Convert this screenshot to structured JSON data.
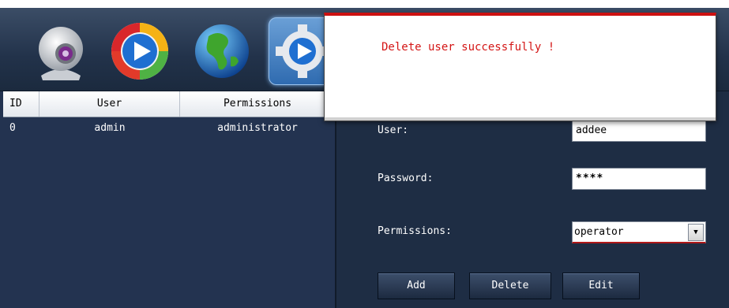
{
  "toolbar": {
    "icons": [
      "webcam-icon",
      "play-icon",
      "globe-icon",
      "settings-gear-icon"
    ]
  },
  "user_table": {
    "headers": {
      "id": "ID",
      "user": "User",
      "permissions": "Permissions"
    },
    "rows": [
      {
        "id": "0",
        "user": "admin",
        "permissions": "administrator"
      }
    ]
  },
  "form": {
    "user_label": "User:",
    "user_value": "addee",
    "password_label": "Password:",
    "password_value": "****",
    "permissions_label": "Permissions:",
    "permissions_value": "operator",
    "add_label": "Add",
    "delete_label": "Delete",
    "edit_label": "Edit"
  },
  "dialog": {
    "message": "Delete user successfully !"
  },
  "colors": {
    "background": "#1f2d42",
    "dialog_accent": "#cc1111",
    "message_text": "#d41515"
  }
}
